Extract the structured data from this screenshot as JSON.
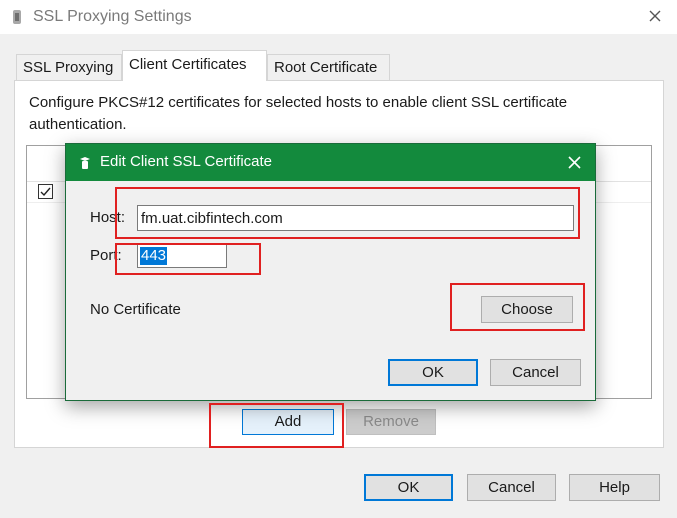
{
  "window": {
    "title": "SSL Proxying Settings"
  },
  "tabs": [
    {
      "label": "SSL Proxying"
    },
    {
      "label": "Client Certificates"
    },
    {
      "label": "Root Certificate"
    }
  ],
  "panel": {
    "description": "Configure PKCS#12 certificates for selected hosts to enable client SSL certificate authentication.",
    "row_checked": true,
    "add_label": "Add",
    "remove_label": "Remove"
  },
  "footer": {
    "ok_label": "OK",
    "cancel_label": "Cancel",
    "help_label": "Help"
  },
  "modal": {
    "title": "Edit Client SSL Certificate",
    "host_label": "Host:",
    "host_value": "fm.uat.cibfintech.com",
    "port_label": "Port:",
    "port_value": "443",
    "certificate_status": "No Certificate",
    "choose_label": "Choose",
    "ok_label": "OK",
    "cancel_label": "Cancel"
  },
  "colors": {
    "modal_titlebar": "#138a3d",
    "focus_border": "#0078d7",
    "annotation": "#e02020"
  }
}
